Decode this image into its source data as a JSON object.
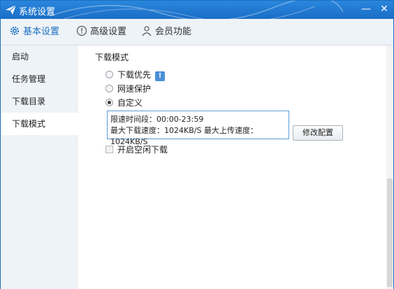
{
  "window": {
    "title": "系统设置",
    "minimize_glyph": "—",
    "close_glyph": "✕"
  },
  "tabs": [
    {
      "label": "基本设置",
      "icon": "gear-icon",
      "active": true
    },
    {
      "label": "高级设置",
      "icon": "exclamation-circle-icon",
      "active": false
    },
    {
      "label": "会员功能",
      "icon": "user-icon",
      "active": false
    }
  ],
  "sidebar": {
    "items": [
      {
        "label": "启动",
        "active": false
      },
      {
        "label": "任务管理",
        "active": false
      },
      {
        "label": "下载目录",
        "active": false
      },
      {
        "label": "下载模式",
        "active": true
      }
    ]
  },
  "content": {
    "section_title": "下载模式",
    "options": [
      {
        "label": "下载优先",
        "checked": false,
        "has_info": true
      },
      {
        "label": "网速保护",
        "checked": false,
        "has_info": false
      },
      {
        "label": "自定义",
        "checked": true,
        "has_info": false
      }
    ],
    "info_glyph": "!",
    "speed_limit_period": "限速时间段：00:00-23:59",
    "speed_limit_rates": "最大下载速度：1024KB/S  最大上传速度：1024KB/S",
    "modify_button": "修改配置",
    "idle_download_label": "开启空闲下载",
    "idle_download_checked": false
  },
  "colors": {
    "titlebar": "#1f6fc0",
    "accent": "#1f6fc0",
    "info_badge": "#4a90d9"
  }
}
